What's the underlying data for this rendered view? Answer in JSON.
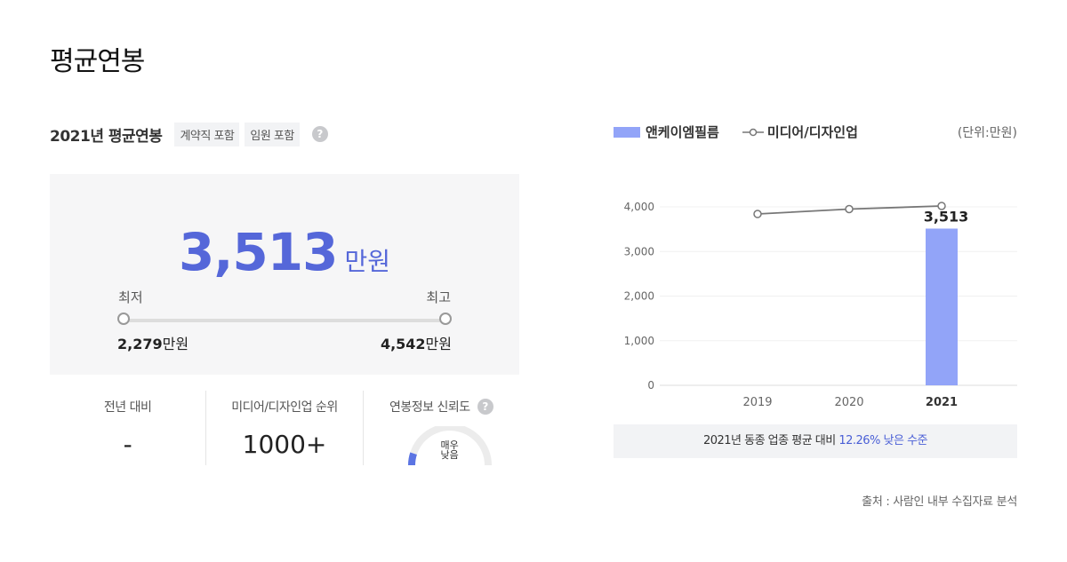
{
  "page_title": "평균연봉",
  "summary": {
    "year_title": "2021년 평균연봉",
    "chips": [
      "계약직 포함",
      "임원 포함"
    ],
    "help_icon": "question-circle-icon",
    "avg_value": "3,513",
    "avg_unit": "만원",
    "min_label": "최저",
    "max_label": "최고",
    "min_value": "2,279",
    "max_value": "4,542",
    "value_unit": "만원"
  },
  "stats": {
    "yoy_label": "전년 대비",
    "yoy_value": "-",
    "rank_label": "미디어/디자인업 순위",
    "rank_value": "1000+",
    "reliability_label": "연봉정보 신뢰도",
    "reliability_value_line1": "매우",
    "reliability_value_line2": "낮음",
    "reliability_level": 0.1
  },
  "legend": {
    "company": "앤케이엠필름",
    "industry": "미디어/디자인업",
    "unit": "(단위:만원)"
  },
  "chart_data": {
    "type": "bar",
    "categories": [
      "2019",
      "2020",
      "2021"
    ],
    "series": [
      {
        "name": "앤케이엠필름",
        "type": "bar",
        "values": [
          null,
          null,
          3513
        ],
        "color": "#92a4f8"
      },
      {
        "name": "미디어/디자인업",
        "type": "line",
        "values": [
          3840,
          3950,
          4020
        ],
        "color": "#777777"
      }
    ],
    "bar_label": "3,513",
    "yticks": [
      "0",
      "1,000",
      "2,000",
      "3,000",
      "4,000"
    ],
    "ylim": [
      0,
      4000
    ],
    "grid": true
  },
  "comparison": {
    "prefix": "2021년 동종 업종 평균 대비 ",
    "highlight": "12.26% 낮은 수준"
  },
  "source": "출처 : 사람인 내부 수집자료 분석"
}
